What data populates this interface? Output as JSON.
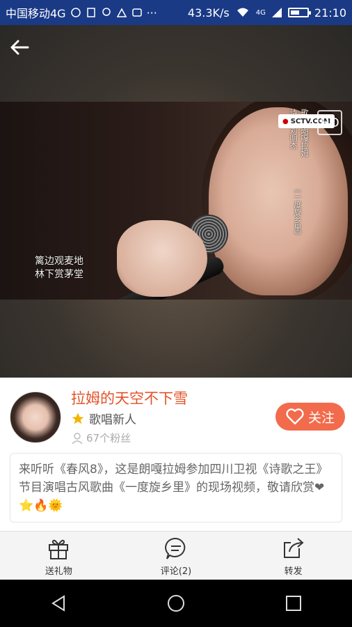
{
  "status_bar": {
    "carrier": "中国移动4G",
    "speed": "43.3K/s",
    "network": "4G",
    "time": "21:10",
    "battery_level": 0.55
  },
  "video": {
    "subtitle_line1": "篱边观麦地",
    "subtitle_line2": "林下赏茅堂",
    "caption_col1": "歌手 朗嘎拉姆",
    "caption_col2": "诗人 刘明杰",
    "caption_col3": "《一度旋乡里》",
    "tv_logo_text": "SCTV.COM",
    "hd_badge_text": "HD"
  },
  "profile": {
    "username": "拉姆的天空不下雪",
    "level_label": "歌唱新人",
    "fans_label": "67个粉丝",
    "follow_label": "关注",
    "description": "来听听《春风8》，这是朗嘎拉姆参加四川卫视《诗歌之王》节目演唱古风歌曲《一度旋乡里》的现场视频，敬请欣赏",
    "description_emojis": "❤⭐🔥🌞"
  },
  "actions": [
    {
      "label": "送礼物",
      "icon": "gift-icon"
    },
    {
      "label": "评论(2)",
      "icon": "comment-icon"
    },
    {
      "label": "转发",
      "icon": "share-icon"
    }
  ],
  "nav": {
    "back": "back-triangle-icon",
    "home": "home-circle-icon",
    "recents": "recents-square-icon"
  },
  "colors": {
    "accent": "#e2532a",
    "follow_button": "#f26b4c",
    "status_bar_bg": "#1a3a86"
  }
}
